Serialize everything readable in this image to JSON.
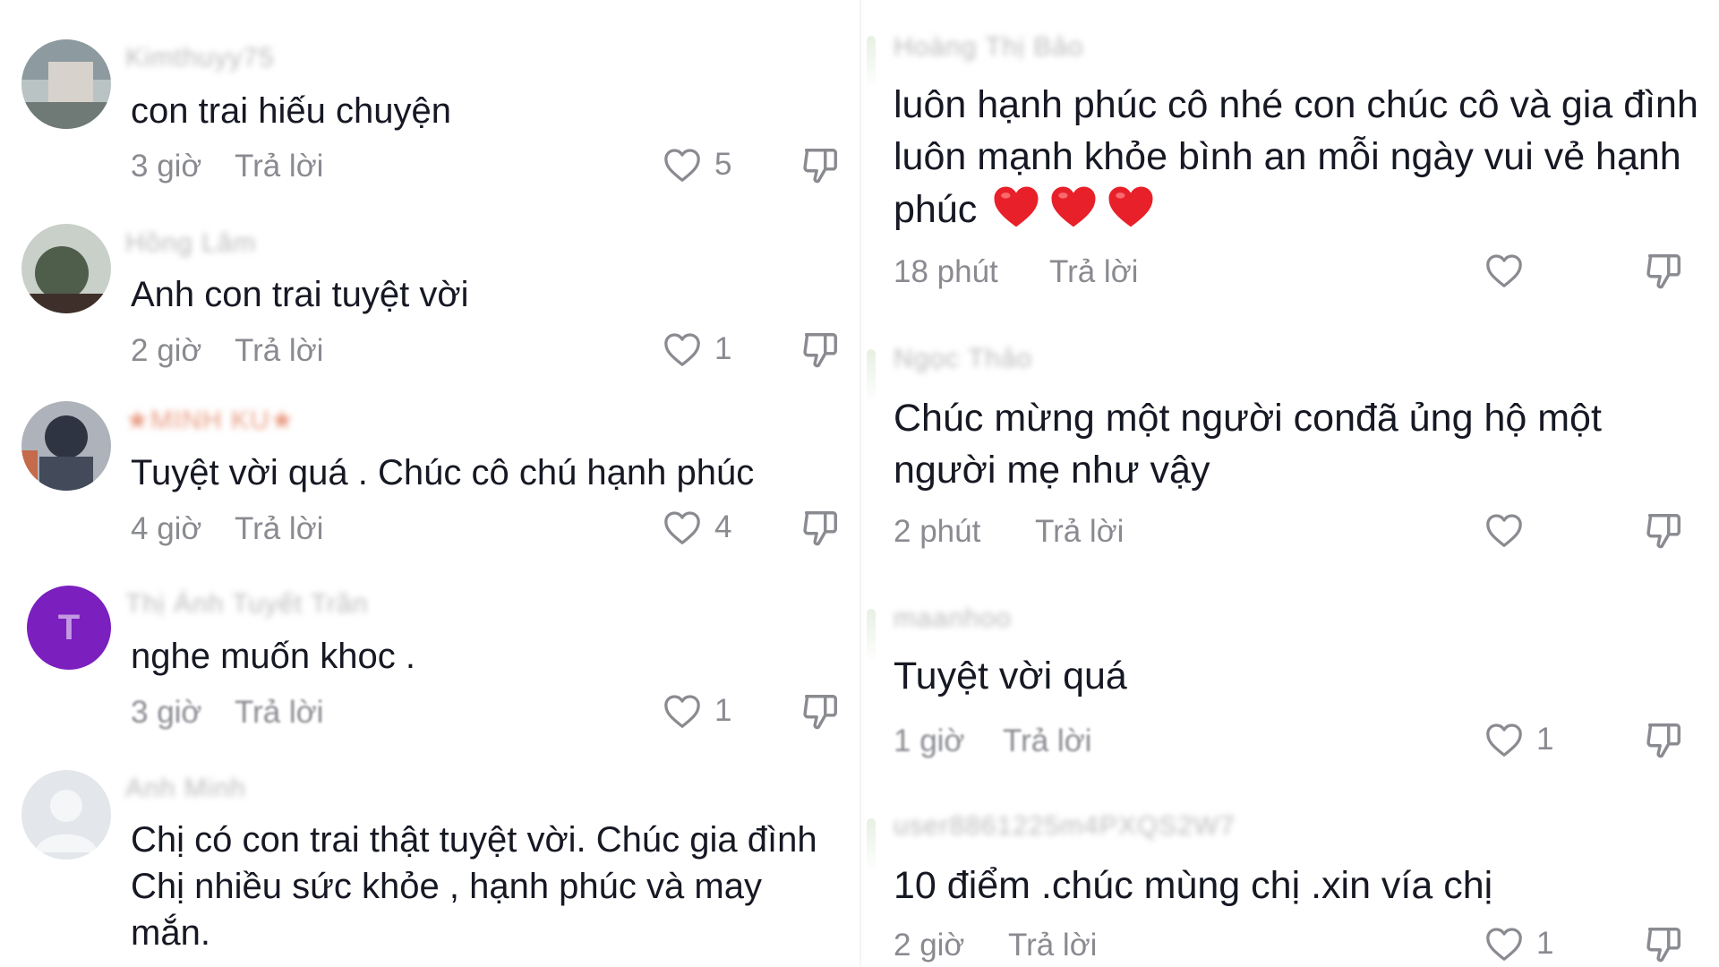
{
  "colors": {
    "text": "#161823",
    "meta": "#8a8b91",
    "heart_red": "#e8202a",
    "avatar_purple": "#7b1fbf"
  },
  "icons": {
    "like": "heart-outline-icon",
    "dislike": "thumbs-down-icon",
    "heart_emoji": "red-heart-emoji"
  },
  "left": {
    "comments": [
      {
        "username": "Kimthuyy75",
        "text": "con trai hiếu chuyện",
        "time": "3 giờ",
        "reply": "Trả lời",
        "likes": "5"
      },
      {
        "username": "Hồng Lâm",
        "text": "Anh con trai tuyệt vời",
        "time": "2 giờ",
        "reply": "Trả lời",
        "likes": "1"
      },
      {
        "username": "★MINH KU★",
        "text": "Tuyệt vời quá . Chúc cô chú hạnh phúc",
        "time": "4 giờ",
        "reply": "Trả lời",
        "likes": "4"
      },
      {
        "username": "Thị Ánh Tuyết Trần",
        "avatar_letter": "T",
        "text": "nghe muốn khoc .",
        "time": "3 giờ",
        "reply": "Trả lời",
        "likes": "1"
      },
      {
        "username": "Anh Minh",
        "text": "Chị có con trai thật tuyệt vời. Chúc gia đình Chị nhiều sức khỏe , hạnh phúc và may mắn.",
        "time": "",
        "reply": "",
        "likes": ""
      }
    ]
  },
  "right": {
    "comments": [
      {
        "username": "Hoàng Thị Bảo",
        "text": "luôn hạnh phúc cô nhé con chúc cô và gia đình luôn mạnh khỏe bình an mỗi ngày vui vẻ hạnh phúc",
        "time": "18 phút",
        "reply": "Trả lời",
        "likes": ""
      },
      {
        "username": "Ngọc Thảo",
        "text": "Chúc mừng một người conđã ủng hộ một người mẹ như vậy",
        "time": "2 phút",
        "reply": "Trả lời",
        "likes": ""
      },
      {
        "username": "maanhoo",
        "text": "Tuyệt vời quá",
        "time": "1 giờ",
        "reply": "Trả lời",
        "likes": "1"
      },
      {
        "username": "user8861225m4PXQS2W7",
        "text": "10 điểm .chúc mùng chị .xin vía chị",
        "time": "2 giờ",
        "reply": "Trả lời",
        "likes": "1"
      }
    ]
  }
}
